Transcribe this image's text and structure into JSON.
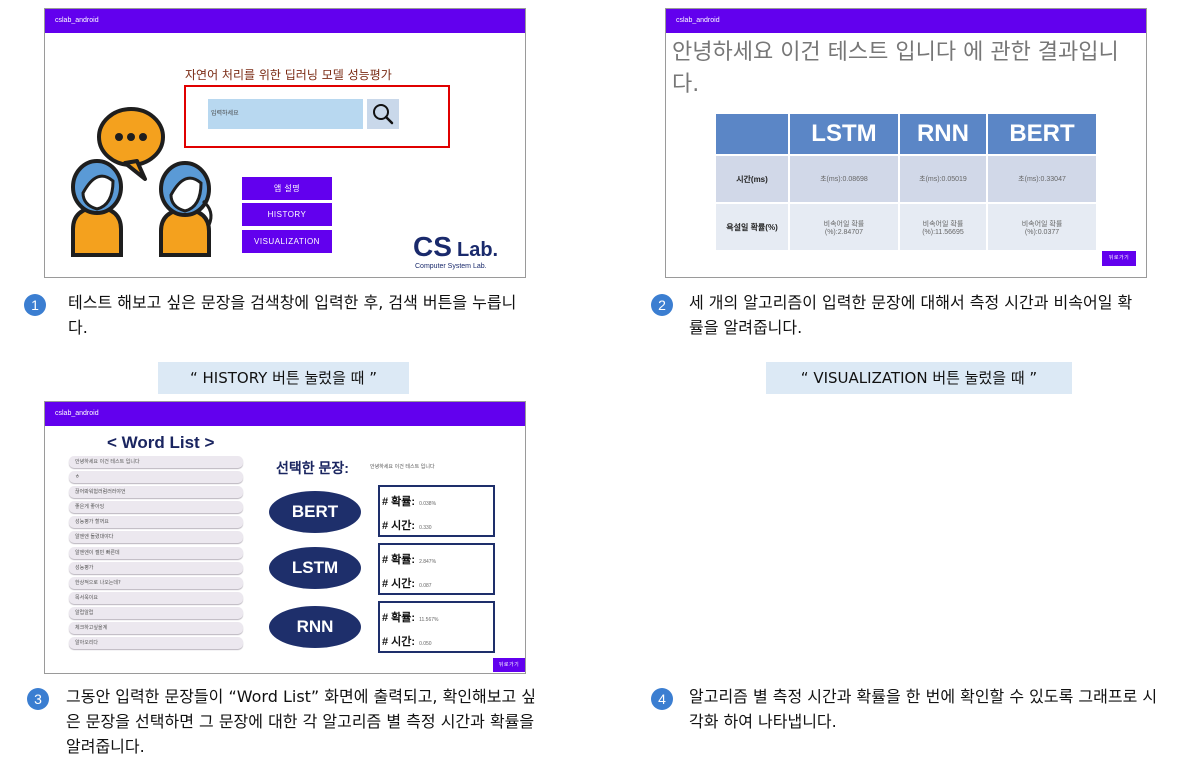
{
  "app_name": "cslab_android",
  "screen1": {
    "title": "자연어 처리를 위한 딥러닝 모델 성능평가",
    "search_placeholder": "입력하세요",
    "buttons": [
      "앱 설명",
      "HISTORY",
      "VISUALIZATION"
    ],
    "logo_cs": "CS",
    "logo_lab": "Lab.",
    "logo_sub": "Computer System Lab."
  },
  "screen2": {
    "heading": "안녕하세요 이건 테스트 입니다 에 관한 결과입니다.",
    "columns": [
      "LSTM",
      "RNN",
      "BERT"
    ],
    "rows": [
      {
        "label": "시간(ms)",
        "values": [
          "초(ms):0.08698",
          "초(ms):0.05019",
          "초(ms):0.33047"
        ]
      },
      {
        "label": "욕설일 확률(%)",
        "values": [
          "비속어일 확률\n(%):2.84707",
          "비속어일 확률\n(%):11.56695",
          "비속어일 확률\n(%):0.0377"
        ]
      }
    ],
    "back_button": "뒤로가기"
  },
  "screen3": {
    "title": "< Word List >",
    "words": [
      "안녕하세요 이건 테스트 입니다",
      "ㅎ",
      "끊어봐워험러럼러러야언",
      "좋은게 좋아잉",
      "성능평가 할꺼요",
      "알엔엔 돌렸대야다",
      "알엔엔이 젤빈 빠른데",
      "성능평가",
      "한상적으로 나오는데?",
      "목서욱이요",
      "알럽알럽",
      "체크하고싶을계",
      "알아오리다"
    ],
    "selected_label": "선택한 문장:",
    "selected_value": "안녕하세요 이건 테스트 입니다",
    "prob_label": "# 확률:",
    "time_label": "# 시간:",
    "results": [
      {
        "algo": "BERT",
        "prob": "0.038%",
        "time": "0.330"
      },
      {
        "algo": "LSTM",
        "prob": "2.847%",
        "time": "0.087"
      },
      {
        "algo": "RNN",
        "prob": "11.567%",
        "time": "0.050"
      }
    ],
    "back_button": "뒤로가기"
  },
  "captions": [
    {
      "num": "1",
      "text": "테스트 해보고 싶은 문장을 검색창에 입력한 후, 검색 버튼을 누릅니다."
    },
    {
      "num": "2",
      "text": "세 개의 알고리즘이 입력한 문장에 대해서 측정 시간과 비속어일 확률을 알려줍니다."
    },
    {
      "num": "3",
      "text": "그동안 입력한 문장들이 “Word List” 화면에 출력되고, 확인해보고 싶은 문장을 선택하면 그 문장에 대한 각 알고리즘 별 측정 시간과 확률을 알려줍니다."
    },
    {
      "num": "4",
      "text": "알고리즘 별 측정 시간과 확률을 한 번에 확인할 수 있도록 그래프로 시각화 하여 나타냅니다."
    }
  ],
  "labels": {
    "history": "“ HISTORY 버튼 눌렀을 때 ”",
    "visualization": "“ VISUALIZATION 버튼 눌렀을 때 ”"
  }
}
